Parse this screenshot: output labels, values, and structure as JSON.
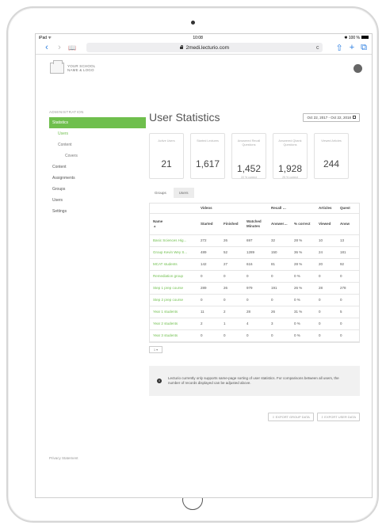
{
  "status": {
    "left": "iPad ᯤ",
    "time": "10:08",
    "right": "✱ 100 %"
  },
  "browser": {
    "url": "2medi.lecturio.com",
    "back": "‹",
    "forward": "›",
    "bookmarks": "📖",
    "reload": "c",
    "share": "⇧",
    "newtab": "+",
    "tabs": "⧉"
  },
  "brand": {
    "line1": "YOUR SCHOOL",
    "line2": "NAME & LOGO"
  },
  "sidebar": {
    "title": "ADMINISTRATION",
    "items": [
      "Statistics",
      "Users",
      "Content",
      "Covers",
      "Content",
      "Assignments",
      "Groups",
      "Users",
      "Settings"
    ]
  },
  "privacy": "Privacy Statement",
  "main": {
    "title": "User Statistics",
    "daterange": "Oct 22, 2017 - Oct 22, 2018",
    "cards": [
      {
        "label": "Active Users",
        "value": "21",
        "sub": ""
      },
      {
        "label": "Started Lectures",
        "value": "1,617",
        "sub": ""
      },
      {
        "label": "Answered Recall Questions",
        "value": "1,452",
        "sub": "22 % correct"
      },
      {
        "label": "Answered Qbank Questions",
        "value": "1,928",
        "sub": "25 % correct"
      },
      {
        "label": "Viewed Articles",
        "value": "244",
        "sub": ""
      }
    ],
    "tabs": [
      "Groups",
      "Users"
    ]
  },
  "table": {
    "group_headers": [
      "",
      "Videos",
      "",
      "",
      "Recall Questions",
      "",
      "Articles",
      "Quest"
    ],
    "columns": [
      "Name",
      "Started",
      "Finished",
      "Watched Minutes",
      "Answered",
      "% correct",
      "Viewed",
      "Answ"
    ],
    "sort_indicator": "▲",
    "rows": [
      [
        "Basic Sciences Hig...",
        "272",
        "26",
        "697",
        "32",
        "28 %",
        "10",
        "13"
      ],
      [
        "Group Kevin Wey S...",
        "489",
        "52",
        "1289",
        "150",
        "36 %",
        "24",
        "181"
      ],
      [
        "MCAT students",
        "142",
        "27",
        "616",
        "81",
        "28 %",
        "20",
        "92"
      ],
      [
        "Remediation group",
        "0",
        "0",
        "0",
        "0",
        "0 %",
        "0",
        "0"
      ],
      [
        "Step 1 prep course",
        "289",
        "26",
        "979",
        "191",
        "26 %",
        "28",
        "278"
      ],
      [
        "Step 2 prep course",
        "0",
        "0",
        "0",
        "0",
        "0 %",
        "0",
        "0"
      ],
      [
        "Year 1 students",
        "11",
        "2",
        "28",
        "26",
        "31 %",
        "0",
        "5"
      ],
      [
        "Year 2 students",
        "2",
        "1",
        "4",
        "3",
        "0 %",
        "0",
        "0"
      ],
      [
        "Year 3 students",
        "0",
        "0",
        "0",
        "0",
        "0 %",
        "0",
        "0"
      ]
    ]
  },
  "pager": "1 ▾",
  "info": {
    "icon": "i",
    "text": "Lecturio currently only supports same-page sorting of user statistics. For comparisons between all users, the number of records displayed can be adjusted above."
  },
  "exports": {
    "selected": "⇩ EXPORT GROUP DATA",
    "all": "⇩ EXPORT USER DATA"
  }
}
